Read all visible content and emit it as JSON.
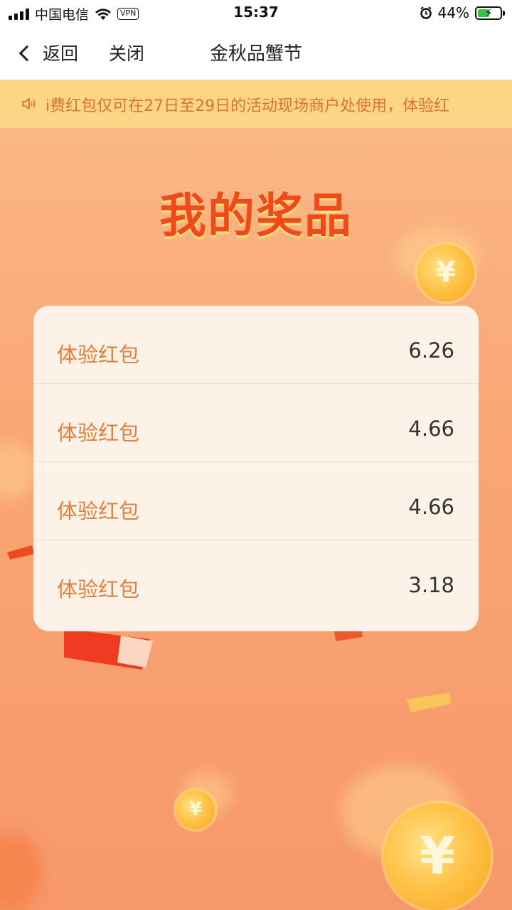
{
  "status_bar": {
    "carrier": "中国电信",
    "vpn": "VPN",
    "time": "15:37",
    "battery_percent": "44%",
    "battery_level": 0.44
  },
  "nav": {
    "back_label": "返回",
    "close_label": "关闭",
    "title": "金秋品蟹节"
  },
  "notice": {
    "text": "i费红包仅可在27日至29日的活动现场商户处使用，体验红"
  },
  "page_title": "我的奖品",
  "prizes": [
    {
      "name": "体验红包",
      "value": "6.26"
    },
    {
      "name": "体验红包",
      "value": "4.66"
    },
    {
      "name": "体验红包",
      "value": "4.66"
    },
    {
      "name": "体验红包",
      "value": "3.18"
    }
  ],
  "decor": {
    "coin_symbol": "¥"
  },
  "colors": {
    "background_top": "#fbb989",
    "background_bottom": "#f7986a",
    "notice_bg": "#fdd587",
    "title_red": "#f04a1a",
    "prize_name": "#e0803a",
    "card_bg": "#fdf2e8"
  }
}
